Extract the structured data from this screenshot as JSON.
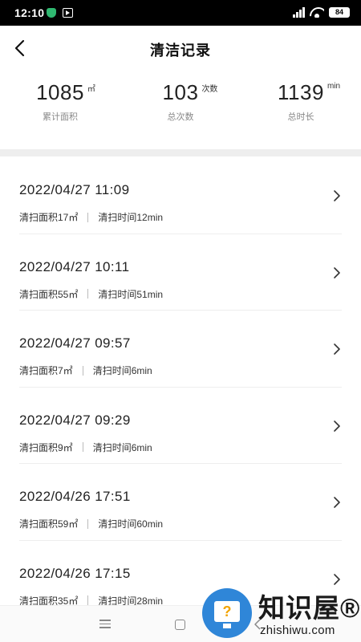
{
  "status_bar": {
    "time": "12:10",
    "battery": "84",
    "icons": [
      "shield-app-icon",
      "media-app-icon",
      "signal-icon",
      "wifi-icon",
      "battery-icon"
    ]
  },
  "header": {
    "title": "清洁记录",
    "back_icon": "back-arrow-icon"
  },
  "stats": [
    {
      "value": "1085",
      "unit": "㎡",
      "label": "累计面积"
    },
    {
      "value": "103",
      "unit": "次数",
      "label": "总次数"
    },
    {
      "value": "1139",
      "unit": "min",
      "label": "总时长"
    }
  ],
  "records": [
    {
      "datetime": "2022/04/27 11:09",
      "area": "清扫面积17㎡",
      "duration": "清扫时间12min"
    },
    {
      "datetime": "2022/04/27 10:11",
      "area": "清扫面积55㎡",
      "duration": "清扫时间51min"
    },
    {
      "datetime": "2022/04/27 09:57",
      "area": "清扫面积7㎡",
      "duration": "清扫时间6min"
    },
    {
      "datetime": "2022/04/27 09:29",
      "area": "清扫面积9㎡",
      "duration": "清扫时间6min"
    },
    {
      "datetime": "2022/04/26 17:51",
      "area": "清扫面积59㎡",
      "duration": "清扫时间60min"
    },
    {
      "datetime": "2022/04/26 17:15",
      "area": "清扫面积35㎡",
      "duration": "清扫时间28min"
    }
  ],
  "watermark": {
    "text": "知识屋®",
    "subtext": "zhishiwu.com",
    "icon_glyph": "?"
  },
  "colors": {
    "background": "#ffffff",
    "divider": "#eeeeee",
    "secondary_text": "#888888",
    "watermark_blue": "#2f86d8"
  }
}
